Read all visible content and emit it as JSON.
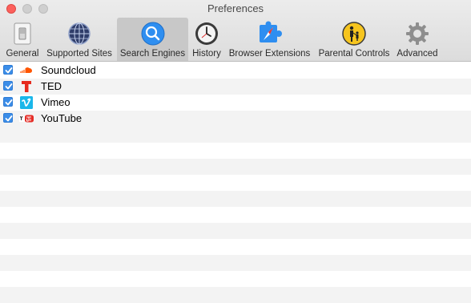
{
  "window": {
    "title": "Preferences"
  },
  "tabs": [
    {
      "label": "General",
      "icon": "general-switch-icon"
    },
    {
      "label": "Supported Sites",
      "icon": "globe-icon"
    },
    {
      "label": "Search Engines",
      "icon": "magnifier-icon",
      "active": true
    },
    {
      "label": "History",
      "icon": "clock-icon"
    },
    {
      "label": "Browser Extensions",
      "icon": "compass-puzzle-icon"
    },
    {
      "label": "Parental Controls",
      "icon": "parental-controls-icon"
    },
    {
      "label": "Advanced",
      "icon": "gear-icon"
    }
  ],
  "engines": [
    {
      "name": "Soundcloud",
      "checked": true,
      "icon": "soundcloud-icon"
    },
    {
      "name": "TED",
      "checked": true,
      "icon": "ted-icon"
    },
    {
      "name": "Vimeo",
      "checked": true,
      "icon": "vimeo-icon"
    },
    {
      "name": "YouTube",
      "checked": true,
      "icon": "youtube-icon"
    }
  ],
  "colors": {
    "accent": "#3b8de8",
    "close": "#fc605c",
    "stripe": "#f3f3f3",
    "soundcloud": "#ff5500",
    "ted": "#e62b1e",
    "vimeo": "#1ab7ea",
    "youtube": "#e52d27"
  }
}
